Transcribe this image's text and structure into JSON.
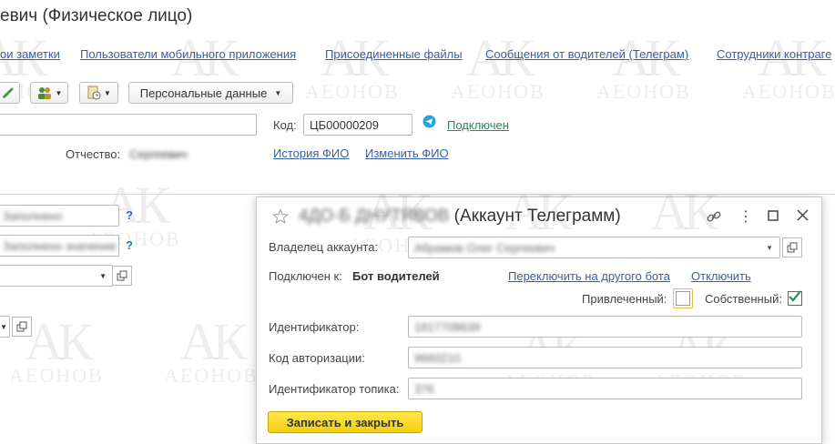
{
  "window": {
    "title": "евич (Физическое лицо)"
  },
  "nav": [
    {
      "label": "ои заметки",
      "name": "nav-notes"
    },
    {
      "label": "Пользователи мобильного приложения",
      "name": "nav-mobile-users"
    },
    {
      "label": "Присоединенные файлы",
      "name": "nav-attached-files"
    },
    {
      "label": "Сообщения от водителей (Телеграм)",
      "name": "nav-driver-messages"
    },
    {
      "label": "Сотрудники контраге",
      "name": "nav-counterparty-staff"
    }
  ],
  "toolbar": {
    "personal_data_label": "Персональные данные"
  },
  "form": {
    "code_label": "Код:",
    "code_value": "ЦБ00000209",
    "telegram_status": "Подключен",
    "patronymic_label": "Отчество:",
    "patronymic_value": "Сергеевич",
    "fio_history_link": "История ФИО",
    "change_fio_link": "Изменить ФИО",
    "left_field1": "Заполнено",
    "left_field2": "Заполнено значение",
    "qmark": "?"
  },
  "dialog": {
    "title_blurred": "4ДО-Б ДНУТЯВОВ",
    "title": "(Аккаунт Телеграмм)",
    "owner_label": "Владелец аккаунта:",
    "owner_value": "Абрамов Олег Сергеевич",
    "connected_to_label": "Подключен к:",
    "connected_to_value": "Бот водителей",
    "switch_bot_link": "Переключить на другого бота",
    "disconnect_link": "Отключить",
    "attracted_label": "Привлеченный:",
    "attracted_checked": false,
    "own_label": "Собственный:",
    "own_checked": true,
    "identifier_label": "Идентификатор:",
    "identifier_value": "1817708639",
    "auth_code_label": "Код авторизации:",
    "auth_code_value": "9660210",
    "topic_id_label": "Идентификатор топика:",
    "topic_id_value": "376",
    "save_close_label": "Записать и закрыть"
  },
  "watermark": {
    "mark": "АК",
    "text": "АЕОНОВ"
  },
  "colors": {
    "link": "#3a5f9e",
    "status_green": "#2e8b57",
    "primary_button": "#f4cf0e"
  }
}
